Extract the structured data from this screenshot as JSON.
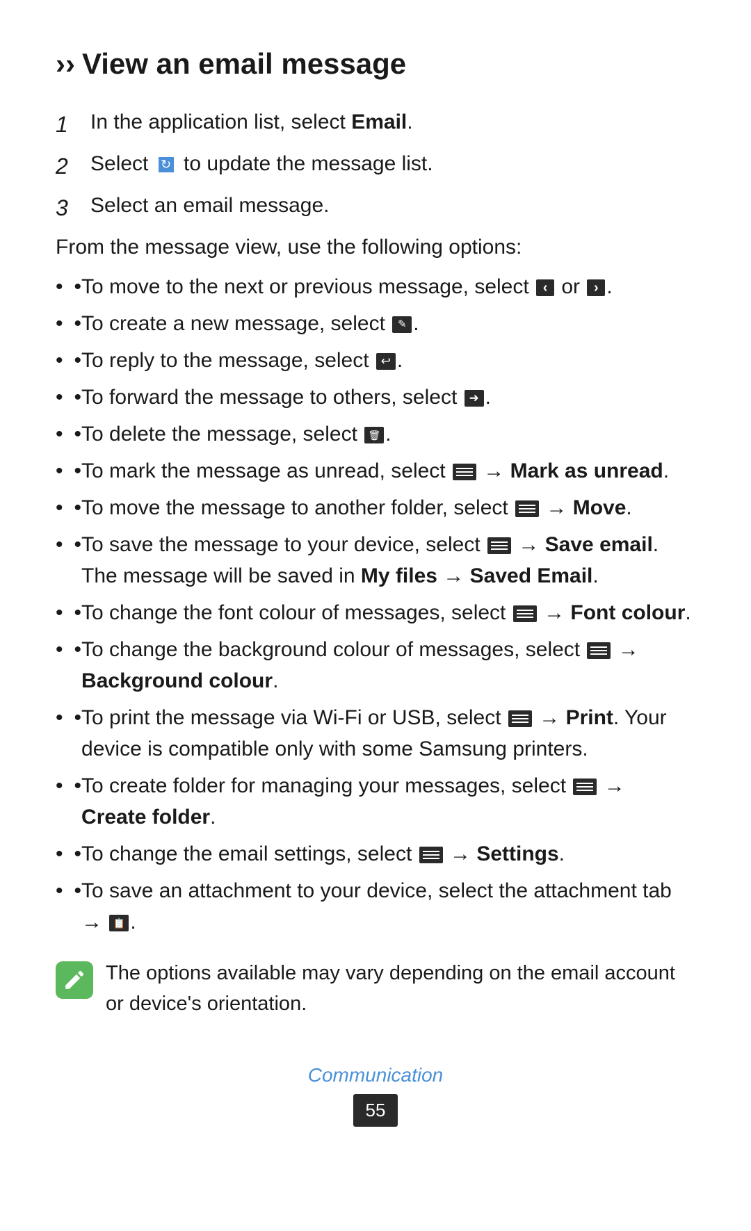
{
  "title": {
    "chevron": "››",
    "text": "View an email message"
  },
  "steps": [
    {
      "number": "1",
      "text_before": "In the application list, select ",
      "bold": "Email",
      "text_after": "."
    },
    {
      "number": "2",
      "text_before": "Select ",
      "icon": "refresh",
      "text_after": " to update the message list."
    },
    {
      "number": "3",
      "text_plain": "Select an email message."
    }
  ],
  "options_intro": "From the message view, use the following options:",
  "bullets": [
    {
      "id": 1,
      "text": "To move to the next or previous message, select [nav-left] or [nav-right]."
    },
    {
      "id": 2,
      "text": "To create a new message, select [compose]."
    },
    {
      "id": 3,
      "text": "To reply to the message, select [reply]."
    },
    {
      "id": 4,
      "text": "To forward the message to others, select [forward]."
    },
    {
      "id": 5,
      "text": "To delete the message, select [delete]."
    },
    {
      "id": 6,
      "text_before": "To mark the message as unread, select [menu] → ",
      "bold": "Mark as unread",
      "text_after": "."
    },
    {
      "id": 7,
      "text_before": "To move the message to another folder, select [menu] → ",
      "bold": "Move",
      "text_after": "."
    },
    {
      "id": 8,
      "text_before": "To save the message to your device, select [menu] → ",
      "bold1": "Save email",
      "text_middle": ". The message will be saved in ",
      "bold2": "My files",
      "arrow": "→",
      "bold3": "Saved Email",
      "text_after": "."
    },
    {
      "id": 9,
      "text_before": "To change the font colour of messages, select [menu] → ",
      "bold": "Font colour",
      "text_after": "."
    },
    {
      "id": 10,
      "text_before": "To change the background colour of messages, select [menu] → ",
      "bold": "Background colour",
      "text_after": "."
    },
    {
      "id": 11,
      "text_before": "To print the message via Wi-Fi or USB, select [menu] → ",
      "bold": "Print",
      "text_after": ". Your device is compatible only with some Samsung printers."
    },
    {
      "id": 12,
      "text_before": "To create folder for managing your messages, select [menu] → ",
      "bold": "Create folder",
      "text_after": "."
    },
    {
      "id": 13,
      "text_before": "To change the email settings, select [menu] → ",
      "bold": "Settings",
      "text_after": "."
    },
    {
      "id": 14,
      "text_before": "To save an attachment to your device, select the attachment tab → [save]."
    }
  ],
  "note": "The options available may vary depending on the email account or device's orientation.",
  "footer": {
    "label": "Communication",
    "page": "55"
  }
}
